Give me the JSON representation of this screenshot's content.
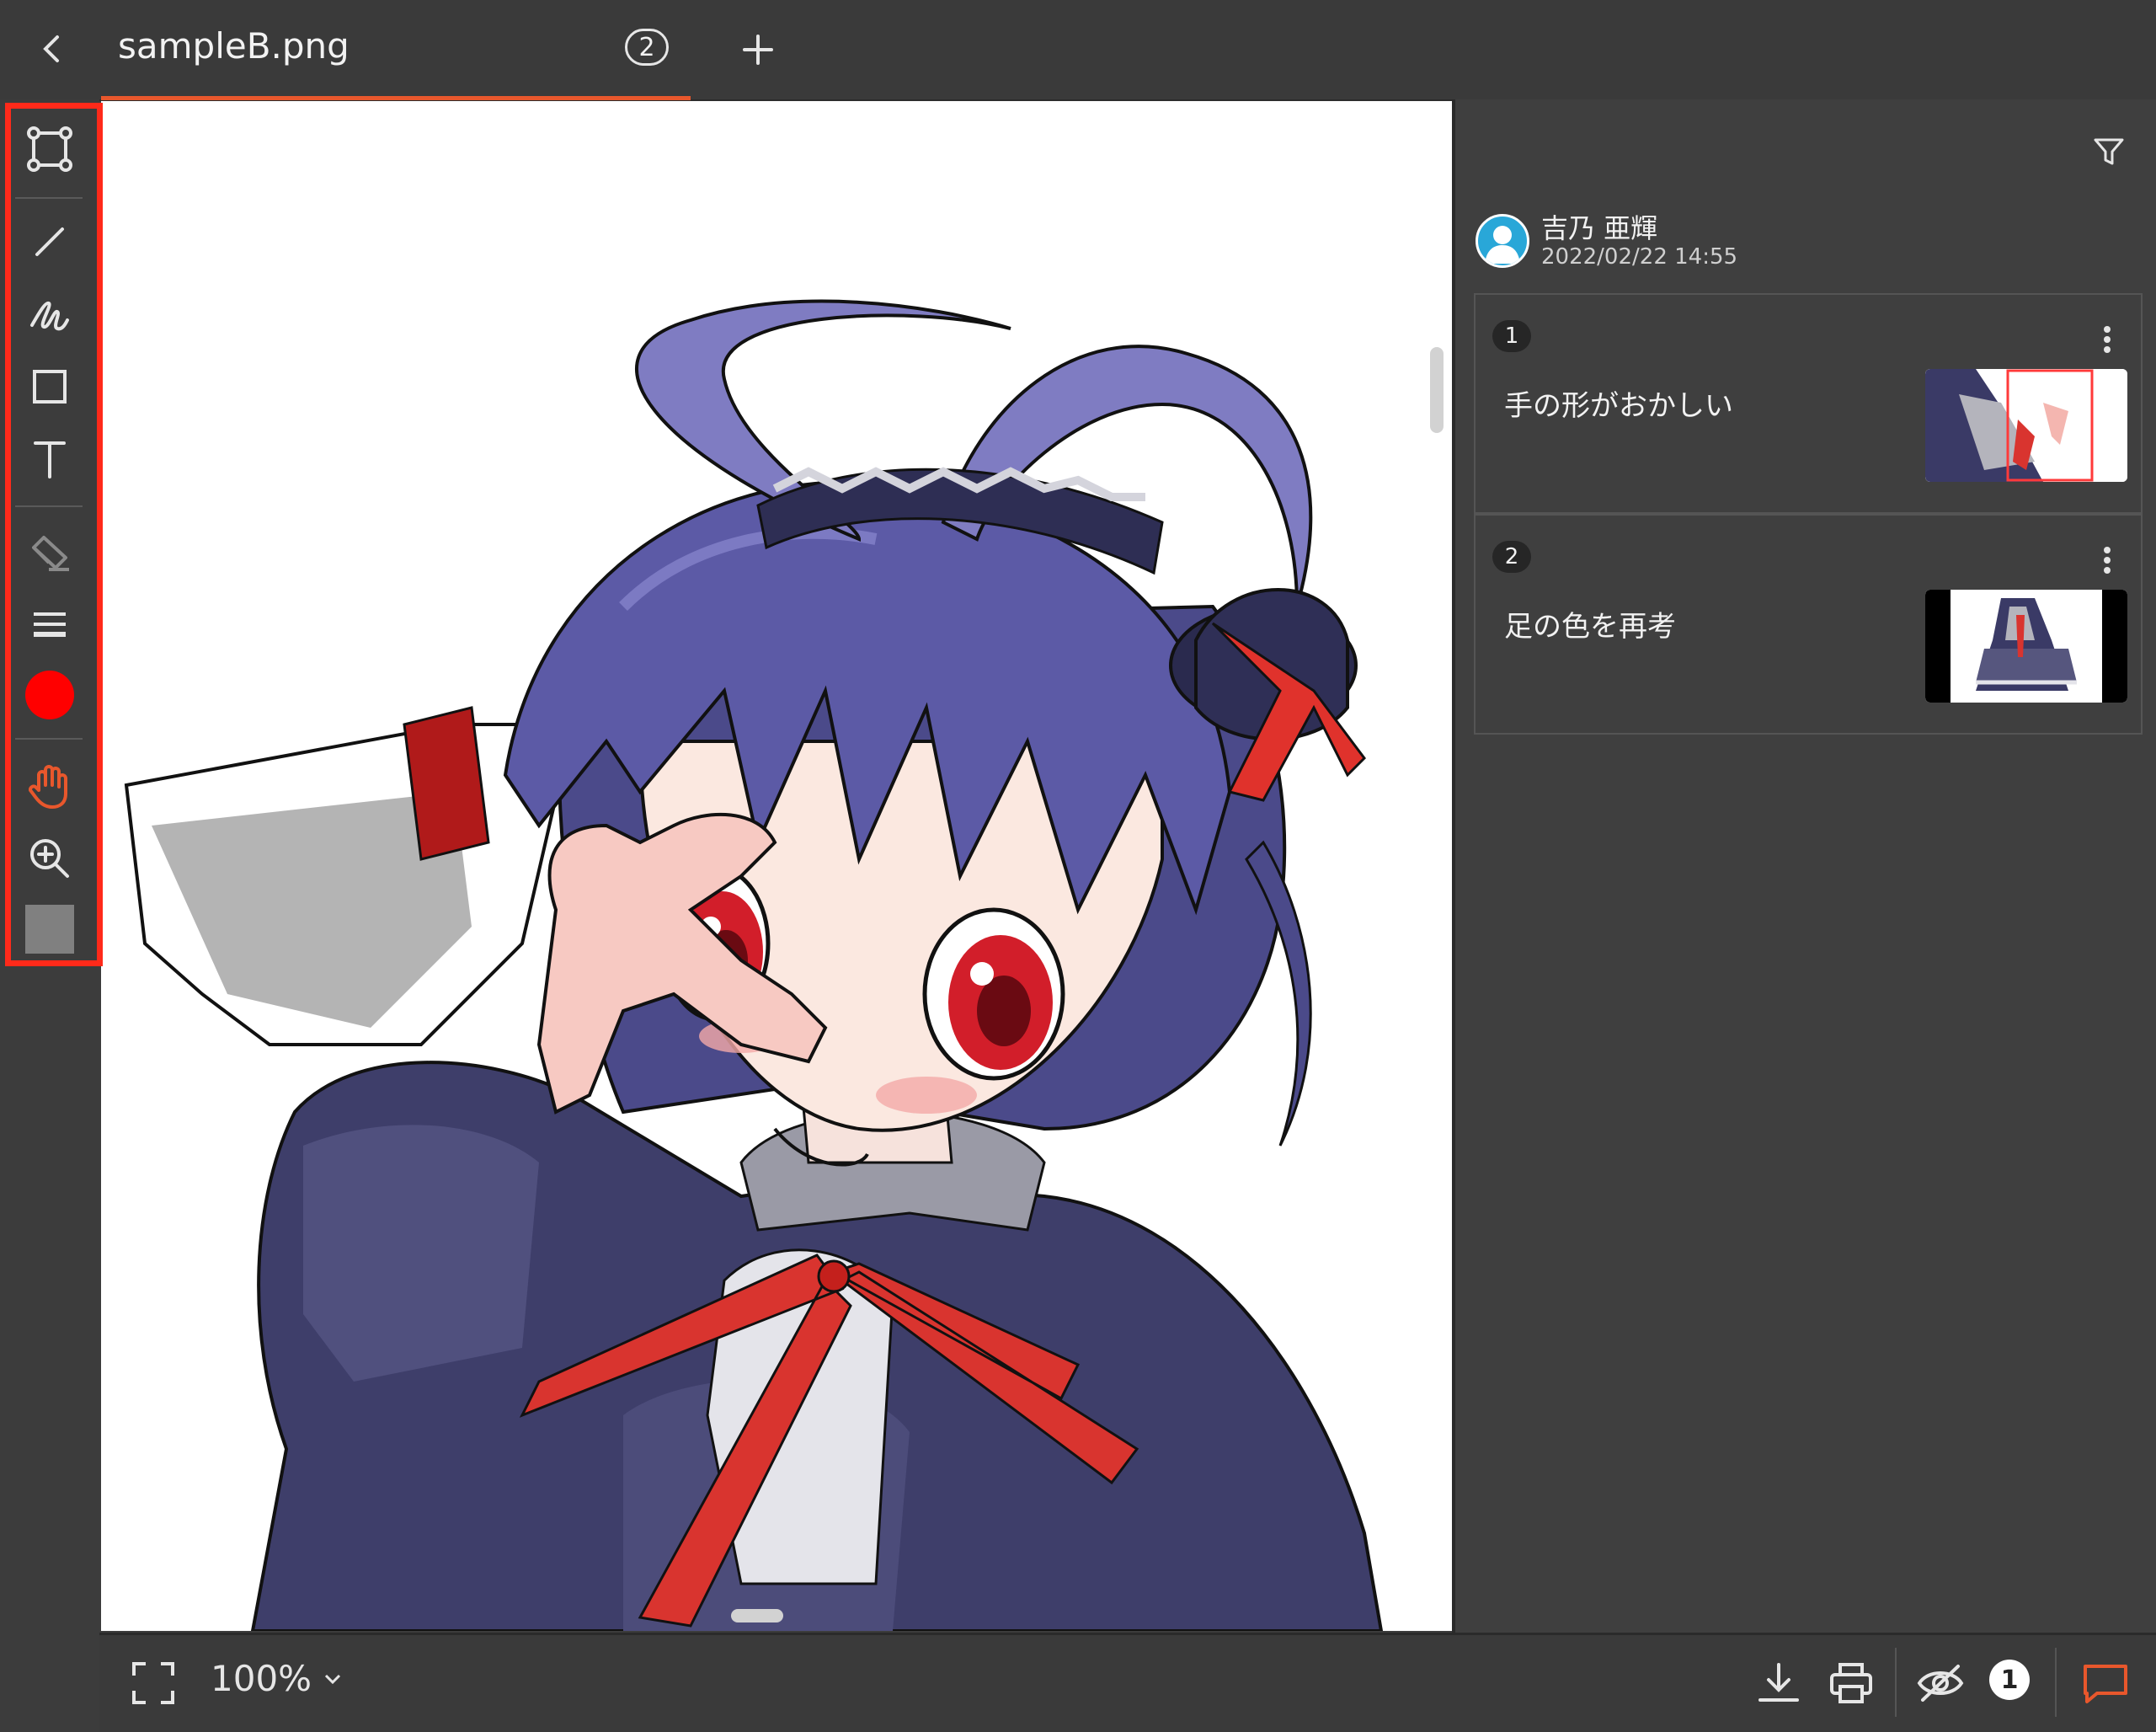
{
  "tab": {
    "title": "sampleB.png",
    "count": "2"
  },
  "tools": [
    "select-tool",
    "line-tool",
    "freehand-tool",
    "rectangle-tool",
    "text-tool",
    "eraser-tool",
    "line-width-tool",
    "color-picker",
    "pan-tool",
    "zoom-tool",
    "fill-color-picker"
  ],
  "colors": {
    "accent": "#e8572c",
    "highlight": "#ff2a1a",
    "pen_color": "#ff0000",
    "fill_color": "#808080"
  },
  "thread": {
    "author": "吉乃 亜輝",
    "datetime": "2022/02/22 14:55"
  },
  "comments": [
    {
      "num": "1",
      "text": "手の形がおかしい"
    },
    {
      "num": "2",
      "text": "足の色を再考"
    }
  ],
  "footer": {
    "zoom": "100%",
    "badge_count": "1"
  }
}
